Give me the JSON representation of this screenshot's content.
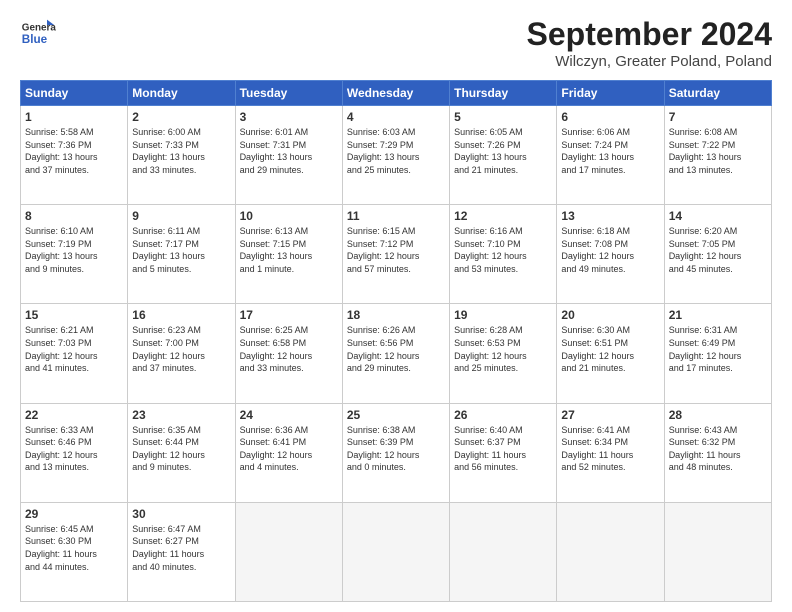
{
  "header": {
    "logo_line1": "General",
    "logo_line2": "Blue",
    "month_title": "September 2024",
    "location": "Wilczyn, Greater Poland, Poland"
  },
  "weekdays": [
    "Sunday",
    "Monday",
    "Tuesday",
    "Wednesday",
    "Thursday",
    "Friday",
    "Saturday"
  ],
  "weeks": [
    [
      {
        "day": "1",
        "info": "Sunrise: 5:58 AM\nSunset: 7:36 PM\nDaylight: 13 hours\nand 37 minutes."
      },
      {
        "day": "2",
        "info": "Sunrise: 6:00 AM\nSunset: 7:33 PM\nDaylight: 13 hours\nand 33 minutes."
      },
      {
        "day": "3",
        "info": "Sunrise: 6:01 AM\nSunset: 7:31 PM\nDaylight: 13 hours\nand 29 minutes."
      },
      {
        "day": "4",
        "info": "Sunrise: 6:03 AM\nSunset: 7:29 PM\nDaylight: 13 hours\nand 25 minutes."
      },
      {
        "day": "5",
        "info": "Sunrise: 6:05 AM\nSunset: 7:26 PM\nDaylight: 13 hours\nand 21 minutes."
      },
      {
        "day": "6",
        "info": "Sunrise: 6:06 AM\nSunset: 7:24 PM\nDaylight: 13 hours\nand 17 minutes."
      },
      {
        "day": "7",
        "info": "Sunrise: 6:08 AM\nSunset: 7:22 PM\nDaylight: 13 hours\nand 13 minutes."
      }
    ],
    [
      {
        "day": "8",
        "info": "Sunrise: 6:10 AM\nSunset: 7:19 PM\nDaylight: 13 hours\nand 9 minutes."
      },
      {
        "day": "9",
        "info": "Sunrise: 6:11 AM\nSunset: 7:17 PM\nDaylight: 13 hours\nand 5 minutes."
      },
      {
        "day": "10",
        "info": "Sunrise: 6:13 AM\nSunset: 7:15 PM\nDaylight: 13 hours\nand 1 minute."
      },
      {
        "day": "11",
        "info": "Sunrise: 6:15 AM\nSunset: 7:12 PM\nDaylight: 12 hours\nand 57 minutes."
      },
      {
        "day": "12",
        "info": "Sunrise: 6:16 AM\nSunset: 7:10 PM\nDaylight: 12 hours\nand 53 minutes."
      },
      {
        "day": "13",
        "info": "Sunrise: 6:18 AM\nSunset: 7:08 PM\nDaylight: 12 hours\nand 49 minutes."
      },
      {
        "day": "14",
        "info": "Sunrise: 6:20 AM\nSunset: 7:05 PM\nDaylight: 12 hours\nand 45 minutes."
      }
    ],
    [
      {
        "day": "15",
        "info": "Sunrise: 6:21 AM\nSunset: 7:03 PM\nDaylight: 12 hours\nand 41 minutes."
      },
      {
        "day": "16",
        "info": "Sunrise: 6:23 AM\nSunset: 7:00 PM\nDaylight: 12 hours\nand 37 minutes."
      },
      {
        "day": "17",
        "info": "Sunrise: 6:25 AM\nSunset: 6:58 PM\nDaylight: 12 hours\nand 33 minutes."
      },
      {
        "day": "18",
        "info": "Sunrise: 6:26 AM\nSunset: 6:56 PM\nDaylight: 12 hours\nand 29 minutes."
      },
      {
        "day": "19",
        "info": "Sunrise: 6:28 AM\nSunset: 6:53 PM\nDaylight: 12 hours\nand 25 minutes."
      },
      {
        "day": "20",
        "info": "Sunrise: 6:30 AM\nSunset: 6:51 PM\nDaylight: 12 hours\nand 21 minutes."
      },
      {
        "day": "21",
        "info": "Sunrise: 6:31 AM\nSunset: 6:49 PM\nDaylight: 12 hours\nand 17 minutes."
      }
    ],
    [
      {
        "day": "22",
        "info": "Sunrise: 6:33 AM\nSunset: 6:46 PM\nDaylight: 12 hours\nand 13 minutes."
      },
      {
        "day": "23",
        "info": "Sunrise: 6:35 AM\nSunset: 6:44 PM\nDaylight: 12 hours\nand 9 minutes."
      },
      {
        "day": "24",
        "info": "Sunrise: 6:36 AM\nSunset: 6:41 PM\nDaylight: 12 hours\nand 4 minutes."
      },
      {
        "day": "25",
        "info": "Sunrise: 6:38 AM\nSunset: 6:39 PM\nDaylight: 12 hours\nand 0 minutes."
      },
      {
        "day": "26",
        "info": "Sunrise: 6:40 AM\nSunset: 6:37 PM\nDaylight: 11 hours\nand 56 minutes."
      },
      {
        "day": "27",
        "info": "Sunrise: 6:41 AM\nSunset: 6:34 PM\nDaylight: 11 hours\nand 52 minutes."
      },
      {
        "day": "28",
        "info": "Sunrise: 6:43 AM\nSunset: 6:32 PM\nDaylight: 11 hours\nand 48 minutes."
      }
    ],
    [
      {
        "day": "29",
        "info": "Sunrise: 6:45 AM\nSunset: 6:30 PM\nDaylight: 11 hours\nand 44 minutes."
      },
      {
        "day": "30",
        "info": "Sunrise: 6:47 AM\nSunset: 6:27 PM\nDaylight: 11 hours\nand 40 minutes."
      },
      {
        "day": "",
        "info": ""
      },
      {
        "day": "",
        "info": ""
      },
      {
        "day": "",
        "info": ""
      },
      {
        "day": "",
        "info": ""
      },
      {
        "day": "",
        "info": ""
      }
    ]
  ]
}
